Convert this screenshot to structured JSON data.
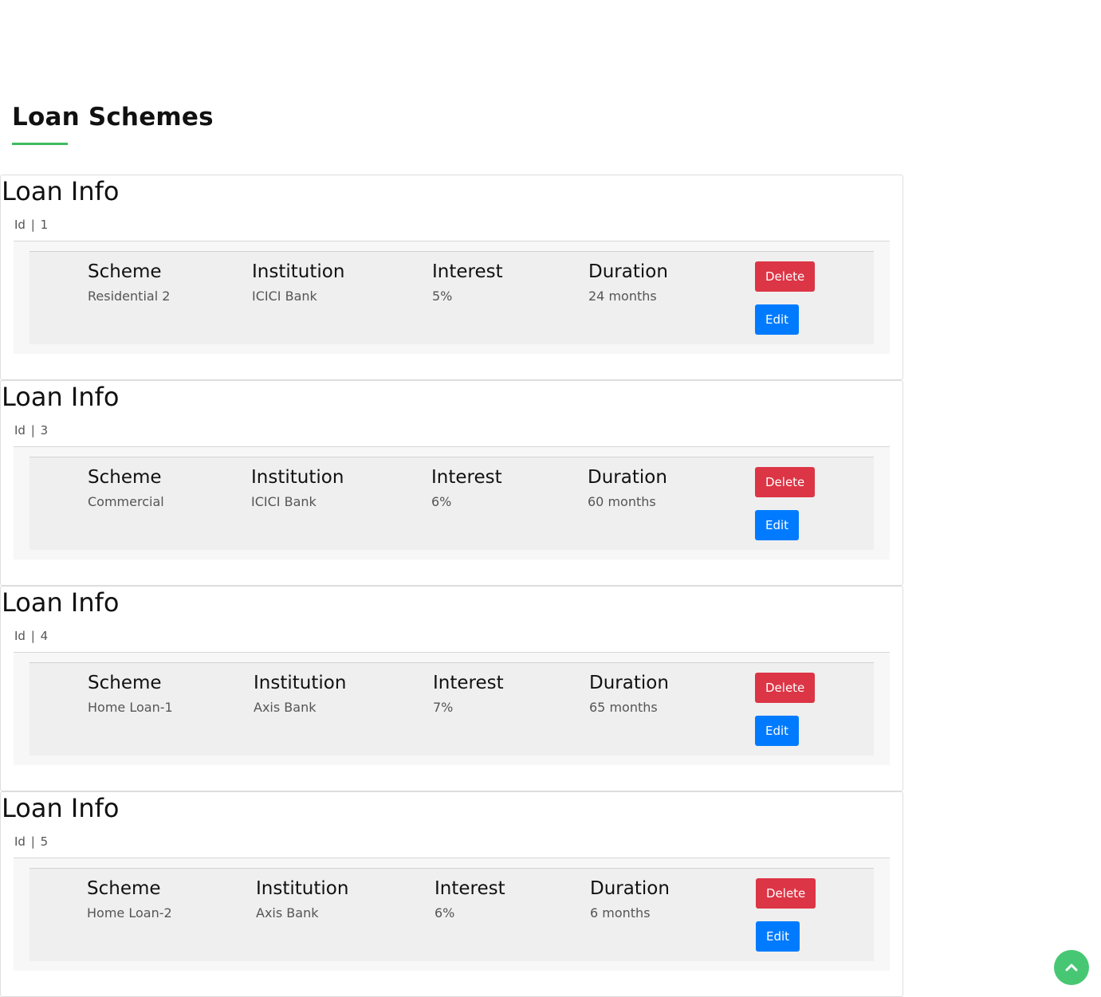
{
  "page": {
    "title": "Loan Schemes"
  },
  "cards": [
    {
      "heading": "Loan Info",
      "id_label": "Id",
      "id_separator": "|",
      "id_value": "1",
      "scheme_label": "Scheme",
      "scheme": "Residential 2",
      "institution_label": "Institution",
      "institution": "ICICI Bank",
      "interest_label": "Interest",
      "interest": "5%",
      "duration_label": "Duration",
      "duration": "24 months",
      "delete_label": "Delete",
      "edit_label": "Edit"
    },
    {
      "heading": "Loan Info",
      "id_label": "Id",
      "id_separator": "|",
      "id_value": "3",
      "scheme_label": "Scheme",
      "scheme": "Commercial",
      "institution_label": "Institution",
      "institution": "ICICI Bank",
      "interest_label": "Interest",
      "interest": "6%",
      "duration_label": "Duration",
      "duration": "60 months",
      "delete_label": "Delete",
      "edit_label": "Edit"
    },
    {
      "heading": "Loan Info",
      "id_label": "Id",
      "id_separator": "|",
      "id_value": "4",
      "scheme_label": "Scheme",
      "scheme": "Home Loan-1",
      "institution_label": "Institution",
      "institution": "Axis Bank",
      "interest_label": "Interest",
      "interest": "7%",
      "duration_label": "Duration",
      "duration": "65 months",
      "delete_label": "Delete",
      "edit_label": "Edit"
    },
    {
      "heading": "Loan Info",
      "id_label": "Id",
      "id_separator": "|",
      "id_value": "5",
      "scheme_label": "Scheme",
      "scheme": "Home Loan-2",
      "institution_label": "Institution",
      "institution": "Axis Bank",
      "interest_label": "Interest",
      "interest": "6%",
      "duration_label": "Duration",
      "duration": "6 months",
      "delete_label": "Delete",
      "edit_label": "Edit"
    }
  ],
  "back_to_top": {
    "icon": "chevron-up-icon"
  },
  "colors": {
    "accent_underline": "#3fbb5f",
    "delete_button": "#dc3545",
    "edit_button": "#007bff",
    "back_to_top": "#47c774"
  }
}
